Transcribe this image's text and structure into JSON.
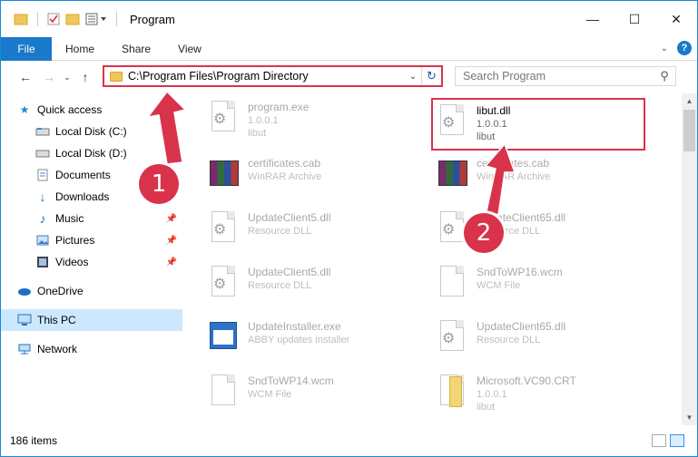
{
  "window": {
    "title": "Program",
    "controls": {
      "minimize": "—",
      "maximize": "☐",
      "close": "✕"
    }
  },
  "ribbon": {
    "file_tab": "File",
    "tabs": [
      "Home",
      "Share",
      "View"
    ]
  },
  "address": {
    "path": "C:\\Program Files\\Program Directory"
  },
  "search": {
    "placeholder": "Search Program"
  },
  "sidebar": {
    "quick_access": "Quick access",
    "items": [
      {
        "label": "Local Disk (C:)"
      },
      {
        "label": "Local Disk (D:)"
      },
      {
        "label": "Documents"
      },
      {
        "label": "Downloads"
      },
      {
        "label": "Music"
      },
      {
        "label": "Pictures"
      },
      {
        "label": "Videos"
      }
    ],
    "onedrive": "OneDrive",
    "thispc": "This PC",
    "network": "Network"
  },
  "files": [
    {
      "name": "program.exe",
      "sub1": "1.0.0.1",
      "sub2": "libut"
    },
    {
      "name": "libut.dll",
      "sub1": "1.0.0.1",
      "sub2": "libut"
    },
    {
      "name": "certificates.cab",
      "sub1": "WinRAR Archive"
    },
    {
      "name": "certificates.cab",
      "sub1": "WinRAR Archive"
    },
    {
      "name": "UpdateClient5.dll",
      "sub1": "Resource DLL"
    },
    {
      "name": "UpdateClient65.dll",
      "sub1": "Resource DLL"
    },
    {
      "name": "UpdateClient5.dll",
      "sub1": "Resource DLL"
    },
    {
      "name": "SndToWP16.wcm",
      "sub1": "WCM File"
    },
    {
      "name": "UpdateInstaller.exe",
      "sub1": "ABBY updates installer"
    },
    {
      "name": "UpdateClient65.dll",
      "sub1": "Resource DLL"
    },
    {
      "name": "SndToWP14.wcm",
      "sub1": "WCM File"
    },
    {
      "name": "Microsoft.VC90.CRT",
      "sub1": "1.0.0.1",
      "sub2": "libut"
    }
  ],
  "status": {
    "item_count": "186 items"
  },
  "annotations": {
    "step1": "1",
    "step2": "2",
    "color": "#d9334b"
  }
}
